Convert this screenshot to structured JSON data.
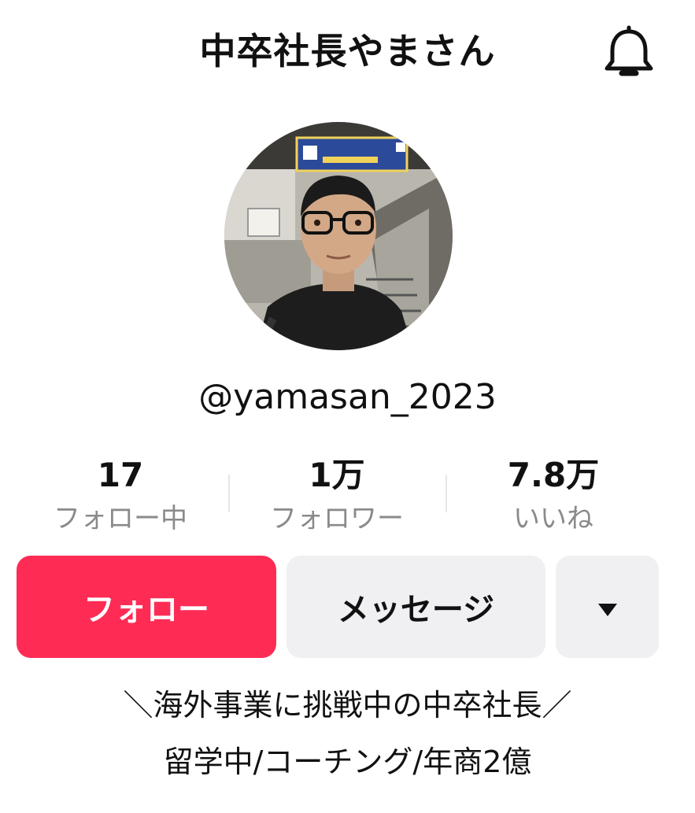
{
  "header": {
    "title": "中卒社長やまさん",
    "notification_icon": "bell-icon"
  },
  "profile": {
    "avatar_alt": "profile photo",
    "username": "@yamasan_2023"
  },
  "stats": [
    {
      "value": "17",
      "label": "フォロー中"
    },
    {
      "value": "1万",
      "label": "フォロワー"
    },
    {
      "value": "7.8万",
      "label": "いいね"
    }
  ],
  "actions": {
    "follow_label": "フォロー",
    "message_label": "メッセージ",
    "more_icon": "triangle-down-icon"
  },
  "bio": {
    "line1": "＼海外事業に挑戦中の中卒社長／",
    "line2": "留学中/コーチング/年商2億"
  },
  "colors": {
    "accent": "#fe2c55",
    "secondary_button": "#f0f0f2",
    "label_gray": "#8a8a8a"
  }
}
